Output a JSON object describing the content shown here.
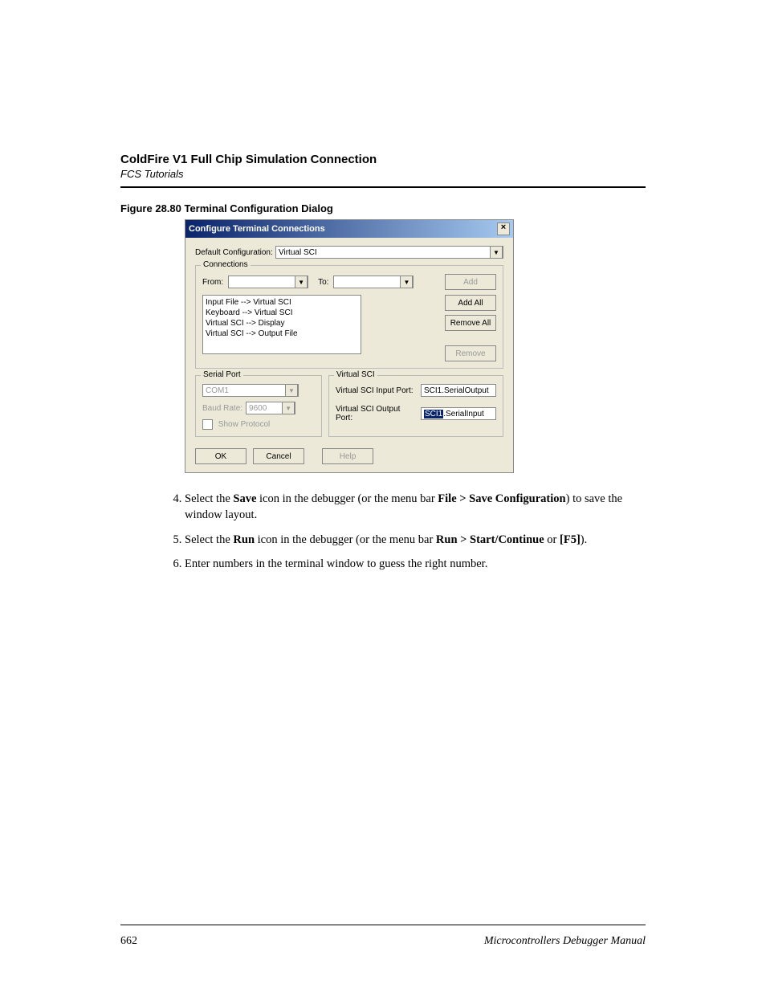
{
  "header": {
    "title": "ColdFire V1 Full Chip Simulation Connection",
    "subtitle": "FCS Tutorials"
  },
  "figure_caption": "Figure 28.80  Terminal Configuration Dialog",
  "dialog": {
    "title": "Configure Terminal Connections",
    "close": "×",
    "default_config_label": "Default Configuration:",
    "default_config_value": "Virtual SCI",
    "connections": {
      "legend": "Connections",
      "from_label": "From:",
      "to_label": "To:",
      "add": "Add",
      "list": [
        "Input File --> Virtual SCI",
        "Keyboard --> Virtual SCI",
        "Virtual SCI --> Display",
        "Virtual SCI --> Output File"
      ],
      "add_all": "Add All",
      "remove_all": "Remove All",
      "remove": "Remove"
    },
    "serial": {
      "legend": "Serial Port",
      "port_value": "COM1",
      "baud_label": "Baud Rate:",
      "baud_value": "9600",
      "show_protocol": "Show Protocol"
    },
    "vsci": {
      "legend": "Virtual SCI",
      "input_label": "Virtual SCI Input Port:",
      "input_value": "SCI1.SerialOutput",
      "output_label": "Virtual SCI Output Port:",
      "output_sel": "SCI1",
      "output_rest": ".SerialInput"
    },
    "buttons": {
      "ok": "OK",
      "cancel": "Cancel",
      "help": "Help"
    }
  },
  "instructions": {
    "i4_a": "Select the ",
    "i4_b": "Save",
    "i4_c": " icon in the debugger (or the menu bar ",
    "i4_d": "File > Save Configuration",
    "i4_e": ") to save the window layout.",
    "i5_a": "Select the ",
    "i5_b": "Run",
    "i5_c": " icon in the debugger (or the menu bar ",
    "i5_d": "Run > Start/Continue",
    "i5_e": " or ",
    "i5_f": "[F5]",
    "i5_g": ").",
    "i6": "Enter numbers in the terminal window to guess the right number."
  },
  "footer": {
    "page": "662",
    "manual": "Microcontrollers Debugger Manual"
  }
}
